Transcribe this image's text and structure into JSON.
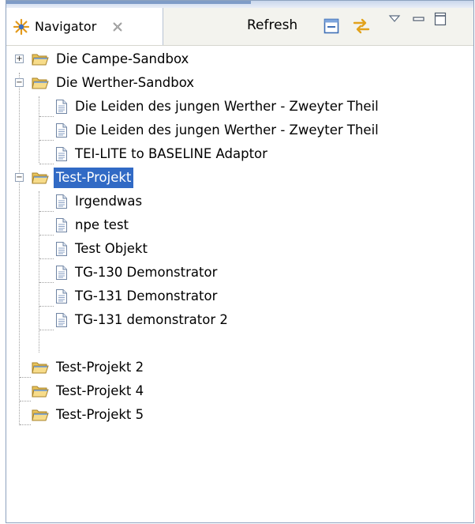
{
  "view": {
    "title": "Navigator",
    "refresh_label": "Refresh",
    "selection_color": "#316ac5"
  },
  "tree": {
    "projects": [
      {
        "label": "Die Campe-Sandbox",
        "expanded": false,
        "icon": "folder-icon",
        "children": []
      },
      {
        "label": "Die Werther-Sandbox",
        "expanded": true,
        "icon": "folder-icon",
        "children": [
          {
            "label": "Die Leiden des jungen Werther - Zweyter Theil",
            "icon": "document-icon"
          },
          {
            "label": "Die Leiden des jungen Werther - Zweyter Theil",
            "icon": "document-icon"
          },
          {
            "label": "TEI-LITE to BASELINE Adaptor",
            "icon": "document-icon"
          }
        ]
      },
      {
        "label": "Test-Projekt",
        "expanded": true,
        "selected": true,
        "icon": "folder-icon",
        "children": [
          {
            "label": "Irgendwas",
            "icon": "document-icon"
          },
          {
            "label": "npe test",
            "icon": "document-icon"
          },
          {
            "label": "Test Objekt",
            "icon": "document-icon"
          },
          {
            "label": "TG-130 Demonstrator",
            "icon": "document-icon"
          },
          {
            "label": "TG-131 Demonstrator",
            "icon": "document-icon"
          },
          {
            "label": "TG-131 demonstrator 2",
            "icon": "document-icon"
          }
        ]
      },
      {
        "label": "Test-Projekt 2",
        "icon": "folder-icon",
        "children": []
      },
      {
        "label": "Test-Projekt 4",
        "icon": "folder-icon",
        "children": []
      },
      {
        "label": "Test-Projekt 5",
        "icon": "folder-icon",
        "children": []
      }
    ]
  }
}
